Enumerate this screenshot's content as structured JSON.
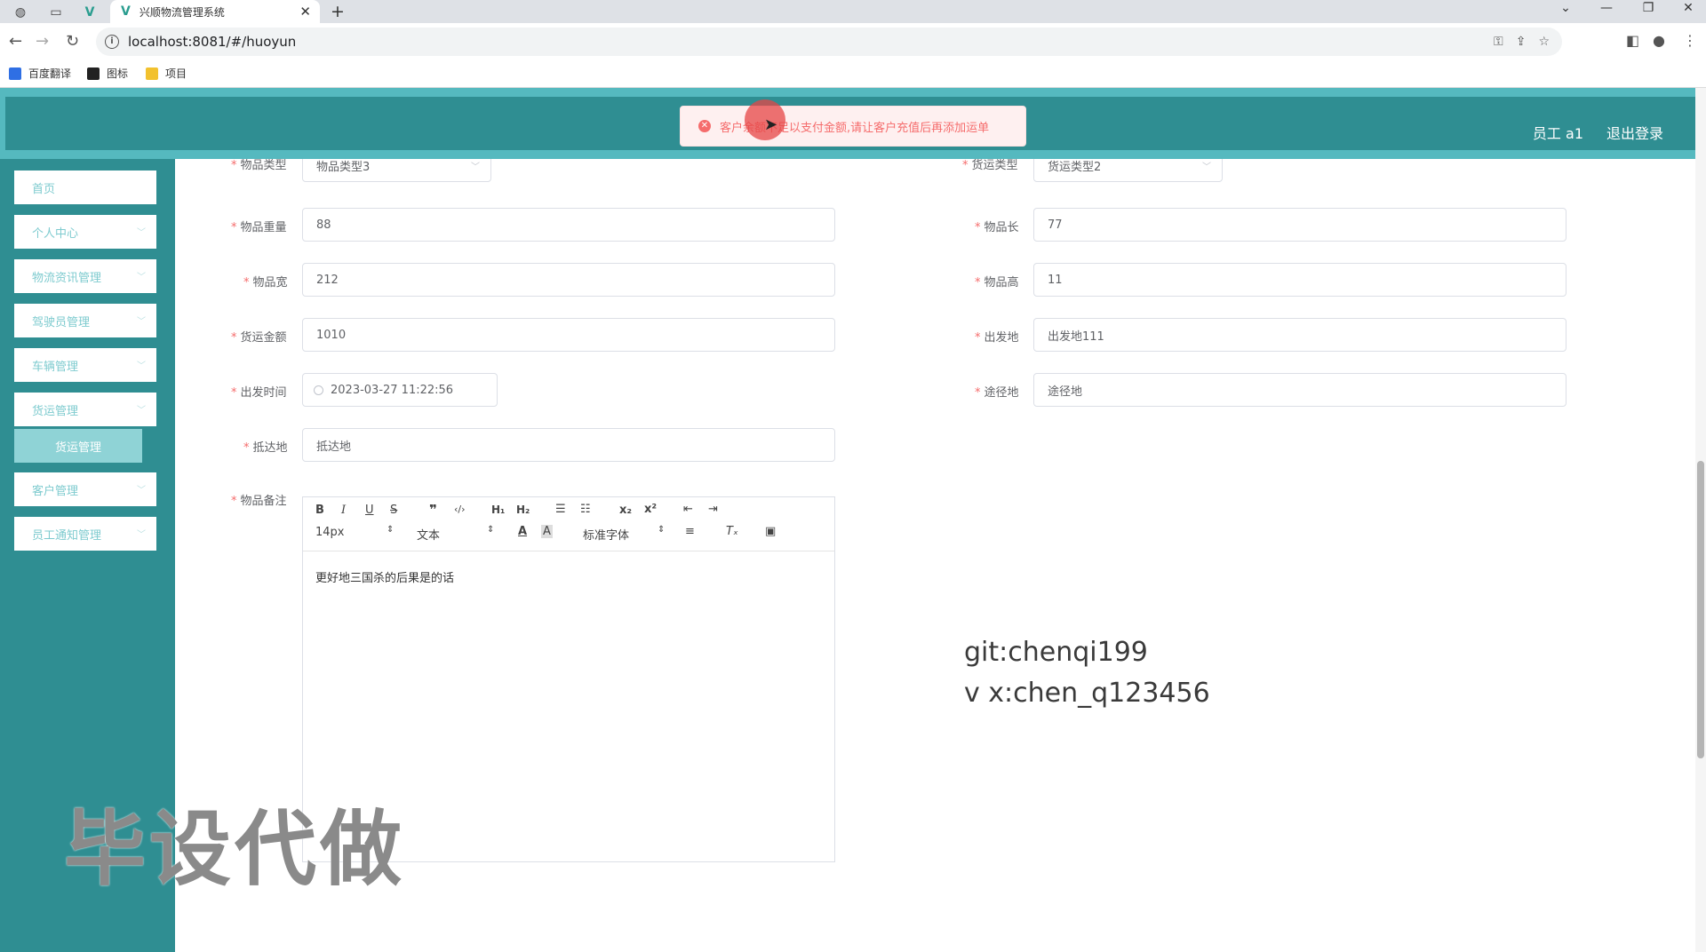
{
  "browser": {
    "tab_title": "兴顺物流管理系统",
    "tab_close": "✕",
    "new_tab": "+",
    "url": "localhost:8081/#/huoyun",
    "bookmarks": [
      {
        "label": "百度翻译",
        "color": "#2f6fe4"
      },
      {
        "label": "图标",
        "color": "#222222"
      },
      {
        "label": "项目",
        "color": "#f2c12e"
      }
    ]
  },
  "header": {
    "user": "员工 a1",
    "logout": "退出登录"
  },
  "alert": {
    "message": "客户余额不足以支付金额,请让客户充值后再添加运单"
  },
  "sidebar": {
    "items": [
      {
        "label": "首页"
      },
      {
        "label": "个人中心"
      },
      {
        "label": "物流资讯管理"
      },
      {
        "label": "驾驶员管理"
      },
      {
        "label": "车辆管理"
      },
      {
        "label": "货运管理"
      },
      {
        "label": "客户管理"
      },
      {
        "label": "员工通知管理"
      }
    ],
    "sub_item": "货运管理"
  },
  "form": {
    "item_type_label": "物品类型",
    "item_type_value": "物品类型3",
    "ship_type_label": "货运类型",
    "ship_type_value": "货运类型2",
    "weight_label": "物品重量",
    "weight_value": "88",
    "length_label": "物品长",
    "length_value": "77",
    "width_label": "物品宽",
    "width_value": "212",
    "height_label": "物品高",
    "height_value": "11",
    "amount_label": "货运金额",
    "amount_value": "1010",
    "origin_label": "出发地",
    "origin_value": "出发地111",
    "depart_time_label": "出发时间",
    "depart_time_value": "2023-03-27 11:22:56",
    "via_label": "途径地",
    "via_value": "途径地",
    "dest_label": "抵达地",
    "dest_value": "抵达地",
    "remark_label": "物品备注"
  },
  "editor": {
    "font_size": "14px",
    "text_style": "文本",
    "font_family": "标准字体",
    "content": "更好地三国杀的后果是的话"
  },
  "watermarks": {
    "line1": "git:chenqi199",
    "line2": "v x:chen_q123456",
    "big": "毕设代做"
  }
}
